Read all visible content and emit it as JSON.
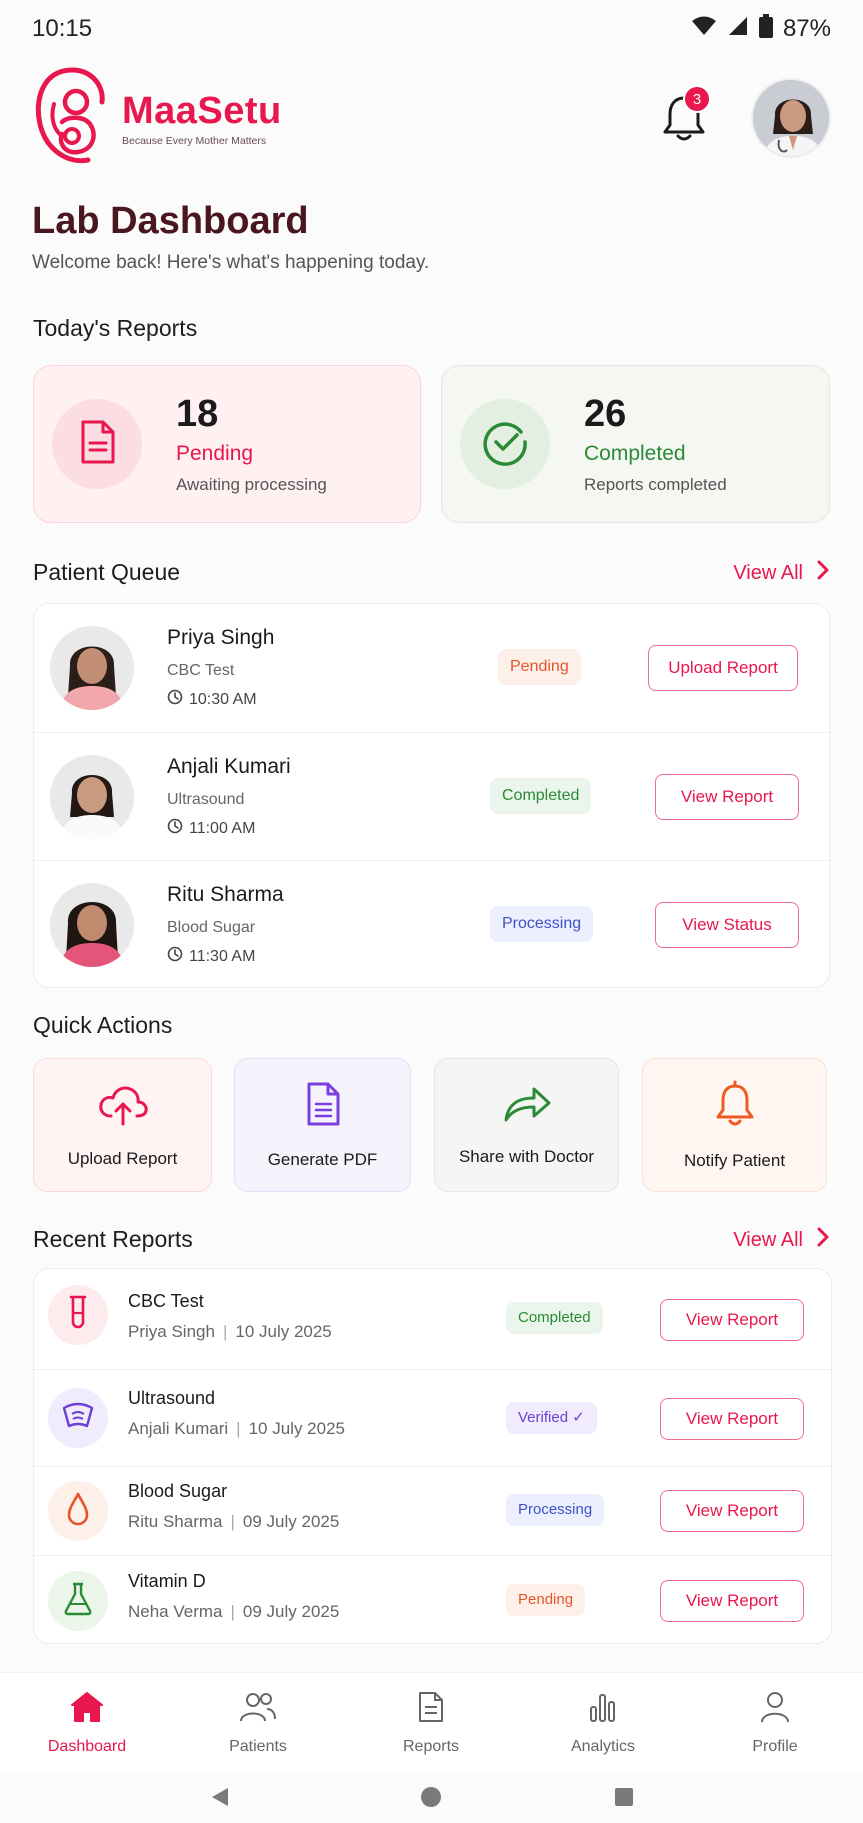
{
  "status": {
    "time": "10:15",
    "battery": "87%"
  },
  "brand": {
    "name": "MaaSetu",
    "tagline": "Because Every Mother Matters"
  },
  "notifications": {
    "count": "3"
  },
  "header": {
    "title": "Lab Dashboard",
    "subtitle": "Welcome back! Here's what's happening today."
  },
  "today": {
    "title": "Today's Reports",
    "pending": {
      "count": "18",
      "label": "Pending",
      "desc": "Awaiting processing"
    },
    "completed": {
      "count": "26",
      "label": "Completed",
      "desc": "Reports completed"
    }
  },
  "queue": {
    "title": "Patient Queue",
    "view_all": "View All",
    "rows": [
      {
        "name": "Priya Singh",
        "test": "CBC Test",
        "time": "10:30 AM",
        "status": "Pending",
        "action": "Upload Report"
      },
      {
        "name": "Anjali Kumari",
        "test": "Ultrasound",
        "time": "11:00 AM",
        "status": "Completed",
        "action": "View Report"
      },
      {
        "name": "Ritu Sharma",
        "test": "Blood Sugar",
        "time": "11:30 AM",
        "status": "Processing",
        "action": "View Status"
      }
    ]
  },
  "quick": {
    "title": "Quick Actions",
    "items": [
      {
        "label": "Upload Report",
        "icon": "cloud-upload-icon"
      },
      {
        "label": "Generate PDF",
        "icon": "document-icon"
      },
      {
        "label": "Share with Doctor",
        "icon": "share-arrow-icon"
      },
      {
        "label": "Notify Patient",
        "icon": "bell-icon"
      }
    ]
  },
  "recent": {
    "title": "Recent Reports",
    "view_all": "View All",
    "rows": [
      {
        "test": "CBC Test",
        "patient": "Priya Singh",
        "sep": "|",
        "date": "10 July 2025",
        "status": "Completed",
        "action": "View Report",
        "icon": "test-tube-icon"
      },
      {
        "test": "Ultrasound",
        "patient": "Anjali Kumari",
        "sep": "|",
        "date": "10 July 2025",
        "status": "Verified ✓",
        "action": "View Report",
        "icon": "ultrasound-icon"
      },
      {
        "test": "Blood Sugar",
        "patient": "Ritu Sharma",
        "sep": "|",
        "date": "09 July 2025",
        "status": "Processing",
        "action": "View Report",
        "icon": "drop-icon"
      },
      {
        "test": "Vitamin D",
        "patient": "Neha Verma",
        "sep": "|",
        "date": "09 July 2025",
        "status": "Pending",
        "action": "View Report",
        "icon": "flask-icon"
      }
    ]
  },
  "nav": {
    "items": [
      {
        "label": "Dashboard",
        "icon": "home-icon"
      },
      {
        "label": "Patients",
        "icon": "users-icon"
      },
      {
        "label": "Reports",
        "icon": "report-icon"
      },
      {
        "label": "Analytics",
        "icon": "bar-chart-icon"
      },
      {
        "label": "Profile",
        "icon": "person-icon"
      }
    ]
  },
  "colors": {
    "accent": "#e8174d",
    "success": "#2a8a36",
    "processing": "#3f52c5",
    "warning": "#e5542a",
    "verified": "#6d3fd6"
  }
}
